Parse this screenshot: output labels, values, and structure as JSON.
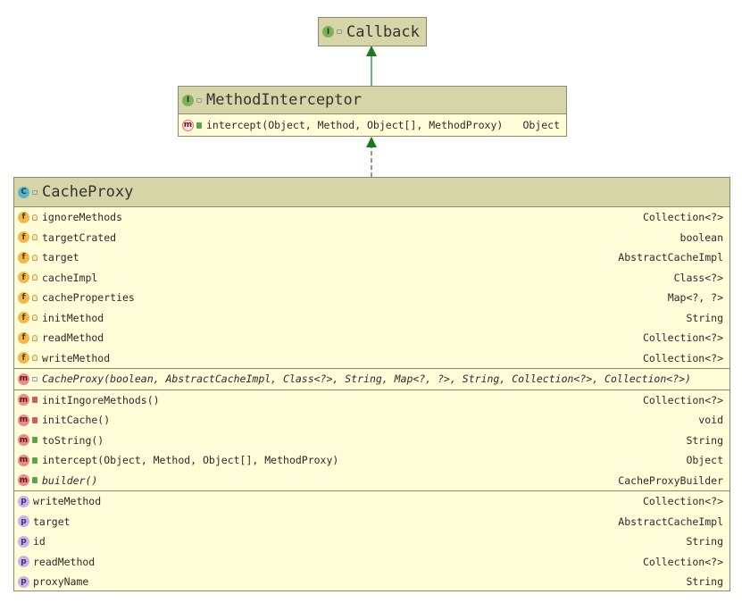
{
  "callback": {
    "name": "Callback",
    "icon": "interface-icon"
  },
  "method_interceptor": {
    "name": "MethodInterceptor",
    "icon": "interface-icon",
    "methods": [
      {
        "name": "intercept(Object, Method, Object[], MethodProxy)",
        "type": "Object"
      }
    ]
  },
  "cache_proxy": {
    "name": "CacheProxy",
    "icon": "class-icon",
    "fields": [
      {
        "name": "ignoreMethods",
        "type": "Collection<?>"
      },
      {
        "name": "targetCrated",
        "type": "boolean"
      },
      {
        "name": "target",
        "type": "AbstractCacheImpl"
      },
      {
        "name": "cacheImpl",
        "type": "Class<?>"
      },
      {
        "name": "cacheProperties",
        "type": "Map<?, ?>"
      },
      {
        "name": "initMethod",
        "type": "String"
      },
      {
        "name": "readMethod",
        "type": "Collection<?>"
      },
      {
        "name": "writeMethod",
        "type": "Collection<?>"
      }
    ],
    "constructor": "CacheProxy(boolean, AbstractCacheImpl, Class<?>, String, Map<?, ?>, String, Collection<?>, Collection<?>)",
    "methods": [
      {
        "name": "initIngoreMethods()",
        "type": "Collection<?>"
      },
      {
        "name": "initCache()",
        "type": "void"
      },
      {
        "name": "toString()",
        "type": "String"
      },
      {
        "name": "intercept(Object, Method, Object[], MethodProxy)",
        "type": "Object"
      },
      {
        "name": "builder()",
        "type": "CacheProxyBuilder"
      }
    ],
    "properties": [
      {
        "name": "writeMethod",
        "type": "Collection<?>"
      },
      {
        "name": "target",
        "type": "AbstractCacheImpl"
      },
      {
        "name": "id",
        "type": "String"
      },
      {
        "name": "readMethod",
        "type": "Collection<?>"
      },
      {
        "name": "proxyName",
        "type": "String"
      }
    ]
  },
  "colors": {
    "header": "#d6d5a8",
    "body": "#fefdd8",
    "arrow": "#1a7a1a"
  }
}
